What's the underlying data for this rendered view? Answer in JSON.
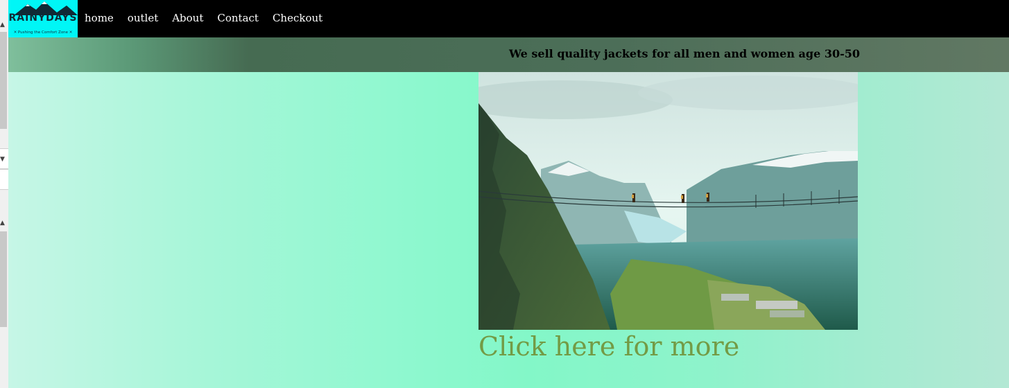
{
  "brand": {
    "name": "RAINYDAYS",
    "tagline": "✕ Pushing the Comfort Zone ✕"
  },
  "nav": {
    "items": [
      {
        "label": "home"
      },
      {
        "label": "outlet"
      },
      {
        "label": "About"
      },
      {
        "label": "Contact"
      },
      {
        "label": "Checkout"
      }
    ]
  },
  "banner": {
    "text": "We sell quality jackets for all men and women age 30-50"
  },
  "main": {
    "link_text": "Click here for more"
  },
  "colors": {
    "nav_bg": "#000000",
    "logo_bg": "#00f6f6",
    "link": "#739b45"
  }
}
